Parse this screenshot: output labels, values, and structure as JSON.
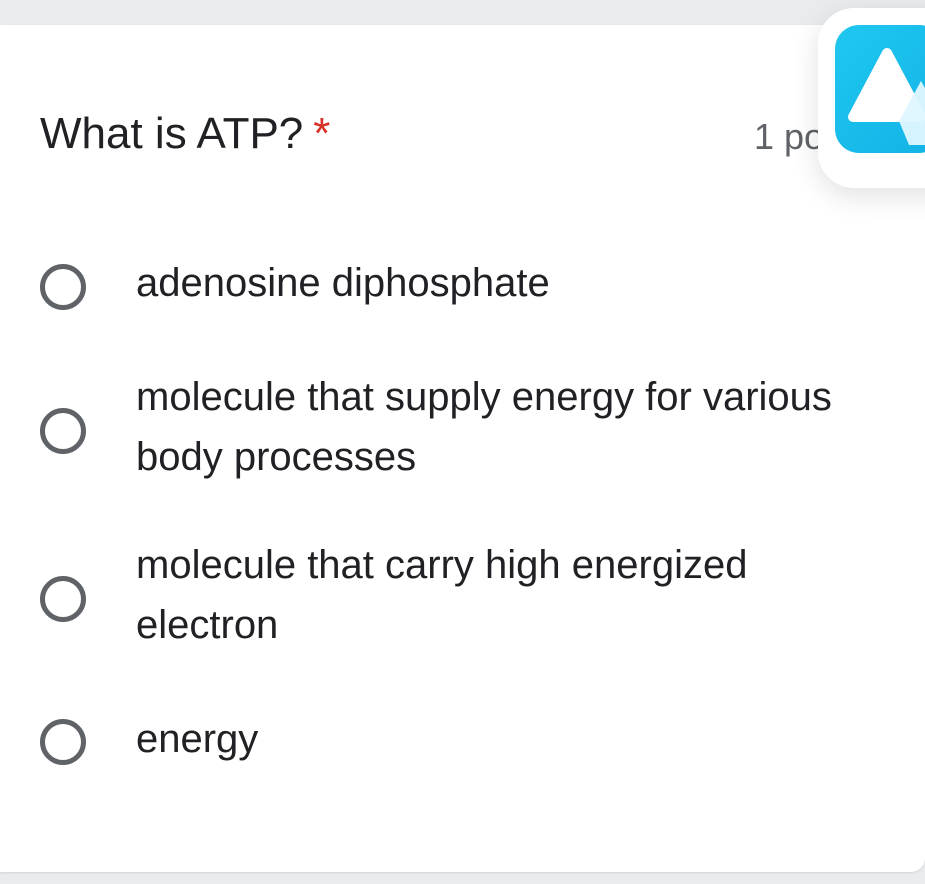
{
  "question": {
    "title": "What is ATP?",
    "required_mark": "*",
    "points": "1 po"
  },
  "options": [
    {
      "label": "adenosine diphosphate",
      "selected": false
    },
    {
      "label": "molecule that supply energy for various body processes",
      "selected": false
    },
    {
      "label": "molecule that carry high energized electron",
      "selected": false
    },
    {
      "label": "energy",
      "selected": false
    }
  ],
  "overlay": {
    "icon": "mountain-app-icon",
    "color": "#1cc3ee"
  },
  "colors": {
    "required": "#d93025",
    "text": "#202124",
    "muted": "#5f6368"
  }
}
